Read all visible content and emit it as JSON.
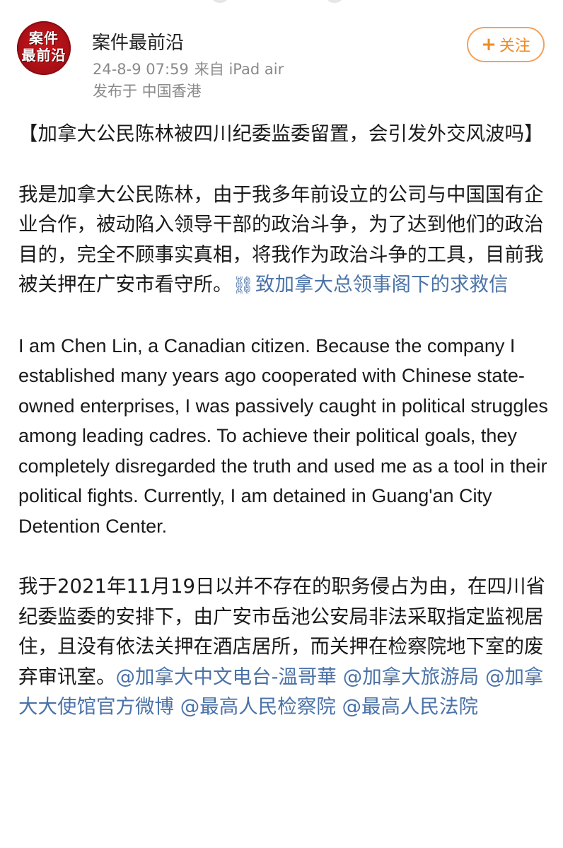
{
  "account": {
    "name": "案件最前沿",
    "avatar_text_line1": "案件",
    "avatar_text_line2": "最前沿",
    "timestamp": "24-8-9 07:59",
    "source": "来自 iPad air",
    "location": "发布于 中国香港",
    "follow_label": "关注",
    "follow_icon": "plus-icon"
  },
  "post": {
    "title": "【加拿大公民陈林被四川纪委监委留置，会引发外交风波吗】",
    "para1_text": "我是加拿大公民陈林，由于我多年前设立的公司与中国国有企业合作，被动陷入领导干部的政治斗争，为了达到他们的政治目的，完全不顾事实真相，将我作为政治斗争的工具，目前我被关押在广安市看守所。",
    "para1_link_icon": "link-icon",
    "para1_link": "致加拿大总领事阁下的求救信",
    "para_en": "I am Chen Lin, a Canadian citizen. Because the company I established many years ago cooperated with Chinese state-owned enterprises, I was passively caught in political struggles among leading cadres. To achieve their political goals, they completely disregarded the truth and used me as a tool in their political fights. Currently, I am detained in Guang'an City Detention Center.",
    "para3_text": "我于2021年11月19日以并不存在的职务侵占为由，在四川省纪委监委的安排下，由广安市岳池公安局非法采取指定监视居住，且没有依法关押在酒店居所，而关押在检察院地下室的废弃审讯室。",
    "mentions": [
      "@加拿大中文电台-溫哥華",
      "@加拿大旅游局",
      "@加拿大大使馆官方微博",
      "@最高人民检察院",
      "@最高人民法院"
    ]
  },
  "colors": {
    "link": "#4a72a8",
    "follow_border": "#f5a15a",
    "follow_text": "#f08a24",
    "meta": "#8a8a8a",
    "avatar_bg": "#c8161d"
  }
}
